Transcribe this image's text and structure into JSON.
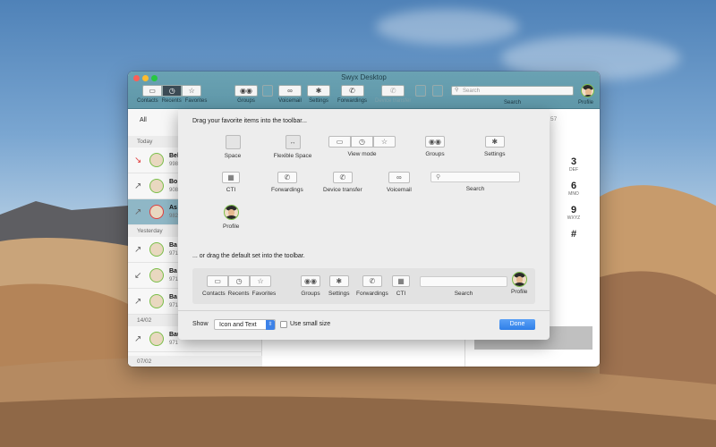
{
  "window": {
    "title": "Swyx Desktop"
  },
  "toolbar": {
    "contacts": "Contacts",
    "recents": "Recents",
    "favorites": "Favorites",
    "groups": "Groups",
    "voicemail": "Voicemail",
    "settings": "Settings",
    "forwardings": "Forwardings",
    "device_transfer": "Device transfer",
    "search_label": "Search",
    "search_placeholder": "Search",
    "profile": "Profile"
  },
  "list": {
    "filter": "All",
    "sections": [
      "Today",
      "Yesterday",
      "14/02",
      "07/02"
    ],
    "rows": [
      {
        "name": "Bel",
        "number": "998"
      },
      {
        "name": "Bo",
        "number": "908"
      },
      {
        "name": "As",
        "number": "982"
      },
      {
        "name": "Ba",
        "number": "971"
      },
      {
        "name": "Ba",
        "number": "971"
      },
      {
        "name": "Ba",
        "number": "971"
      },
      {
        "name": "Bauer Nadine",
        "number": "971"
      }
    ]
  },
  "right_panel": {
    "partial_number": "57",
    "keys": [
      {
        "digit": "3",
        "letters": "DEF"
      },
      {
        "digit": "6",
        "letters": "MNO"
      },
      {
        "digit": "9",
        "letters": "WXYZ"
      },
      {
        "digit": "#",
        "letters": ""
      }
    ]
  },
  "sheet": {
    "drag_favorites": "Drag your favorite items into the toolbar...",
    "drag_default": "... or drag the default set into the toolbar.",
    "palette": {
      "space": "Space",
      "flexible_space": "Flexible Space",
      "view_mode": "View mode",
      "groups": "Groups",
      "settings": "Settings",
      "cti": "CTI",
      "forwardings": "Forwardings",
      "device_transfer": "Device transfer",
      "voicemail": "Voicemail",
      "search": "Search",
      "search_placeholder": "Search",
      "profile": "Profile"
    },
    "default_set": {
      "contacts": "Contacts",
      "recents": "Recents",
      "favorites": "Favorites",
      "groups": "Groups",
      "settings": "Settings",
      "forwardings": "Forwardings",
      "cti": "CTI",
      "search": "Search",
      "profile": "Profile"
    },
    "show_label": "Show",
    "show_value": "Icon and Text",
    "small_size_label": "Use small size",
    "done": "Done"
  },
  "colors": {
    "accent": "#2f7fe8",
    "titlebar": "#5f97a8",
    "presence": "#7bbf4a",
    "missed": "#e04040"
  }
}
